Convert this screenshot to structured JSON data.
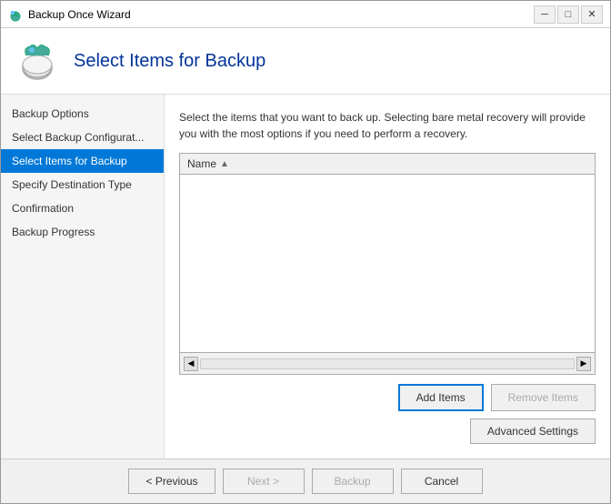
{
  "window": {
    "title": "Backup Once Wizard",
    "close_label": "✕",
    "minimize_label": "─",
    "maximize_label": "□"
  },
  "header": {
    "title": "Select Items for Backup"
  },
  "sidebar": {
    "items": [
      {
        "label": "Backup Options",
        "active": false
      },
      {
        "label": "Select Backup Configurat...",
        "active": false
      },
      {
        "label": "Select Items for Backup",
        "active": true
      },
      {
        "label": "Specify Destination Type",
        "active": false
      },
      {
        "label": "Confirmation",
        "active": false
      },
      {
        "label": "Backup Progress",
        "active": false
      }
    ]
  },
  "main": {
    "description": "Select the items that you want to back up. Selecting bare metal recovery will provide you with the most options if you need to perform a recovery.",
    "table": {
      "column_name": "Name",
      "sort_icon": "▲"
    },
    "buttons": {
      "add_items": "Add Items",
      "remove_items": "Remove Items",
      "advanced_settings": "Advanced Settings"
    }
  },
  "footer": {
    "previous": "< Previous",
    "next": "Next >",
    "backup": "Backup",
    "cancel": "Cancel"
  }
}
